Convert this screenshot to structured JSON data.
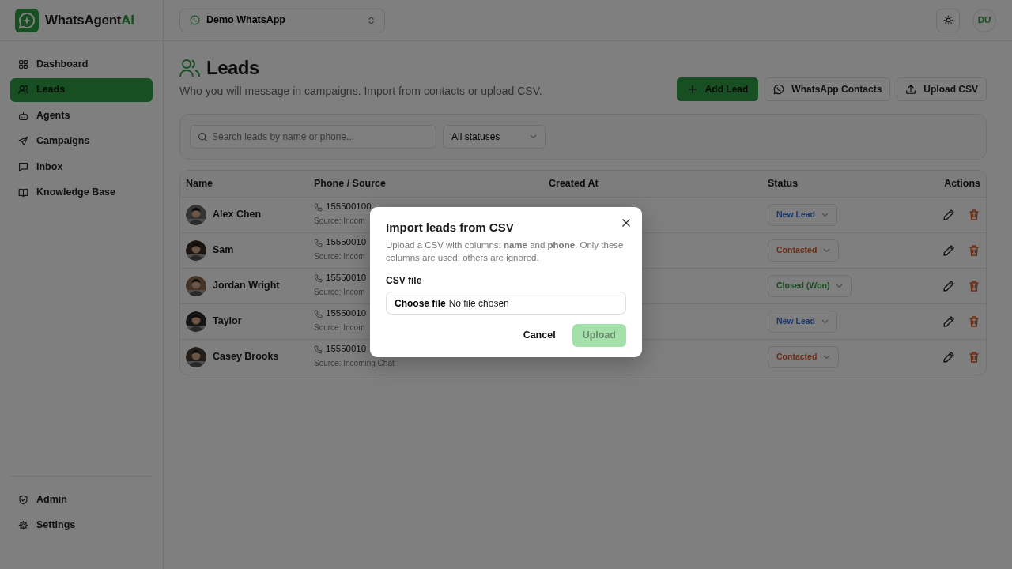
{
  "brand": {
    "name": "WhatsAgent",
    "accent": "AI"
  },
  "workspace": {
    "label": "Demo WhatsApp"
  },
  "user": {
    "initials": "DU"
  },
  "sidebar": {
    "items": [
      {
        "label": "Dashboard",
        "selected": false
      },
      {
        "label": "Leads",
        "selected": true
      },
      {
        "label": "Agents",
        "selected": false
      },
      {
        "label": "Campaigns",
        "selected": false
      },
      {
        "label": "Inbox",
        "selected": false
      },
      {
        "label": "Knowledge Base",
        "selected": false
      }
    ],
    "bottom_items": [
      {
        "label": "Admin",
        "selected": false
      },
      {
        "label": "Settings",
        "selected": false
      }
    ]
  },
  "page": {
    "title": "Leads",
    "subtitle": "Who you will message in campaigns. Import from contacts or upload CSV.",
    "actions": [
      {
        "label": "Add Lead",
        "kind": "primary"
      },
      {
        "label": "WhatsApp Contacts",
        "kind": "outline"
      },
      {
        "label": "Upload CSV",
        "kind": "outline"
      }
    ]
  },
  "filters": {
    "search": {
      "placeholder": "Search leads by name or phone..."
    },
    "status": {
      "value": "All statuses"
    }
  },
  "table": {
    "columns": [
      "Name",
      "Phone / Source",
      "Created At",
      "Status",
      "Actions"
    ],
    "rows": [
      {
        "name": "Alex Chen",
        "phone": "155500100",
        "source": "Source: Incom",
        "status": "New Lead",
        "kind": "new"
      },
      {
        "name": "Sam",
        "phone": "15550010",
        "source": "Source: Incom",
        "status": "Contacted",
        "kind": "contacted"
      },
      {
        "name": "Jordan Wright",
        "phone": "15550010",
        "source": "Source: Incom",
        "status": "Closed (Won)",
        "kind": "won"
      },
      {
        "name": "Taylor",
        "phone": "15550010",
        "source": "Source: Incom",
        "status": "New Lead",
        "kind": "new"
      },
      {
        "name": "Casey Brooks",
        "phone": "15550010",
        "source": "Source: Incoming Chat",
        "status": "Contacted",
        "kind": "contacted"
      }
    ]
  },
  "modal": {
    "title": "Import leads from CSV",
    "description": "Upload a CSV with columns: **name** and **phone**. Only these columns are used; others are ignored.",
    "field_label": "CSV file",
    "file_button": "Choose file",
    "file_status": "No file chosen",
    "buttons": [
      {
        "label": "Cancel",
        "kind": "link",
        "disabled": false
      },
      {
        "label": "Upload",
        "kind": "primary",
        "disabled": true
      }
    ]
  }
}
